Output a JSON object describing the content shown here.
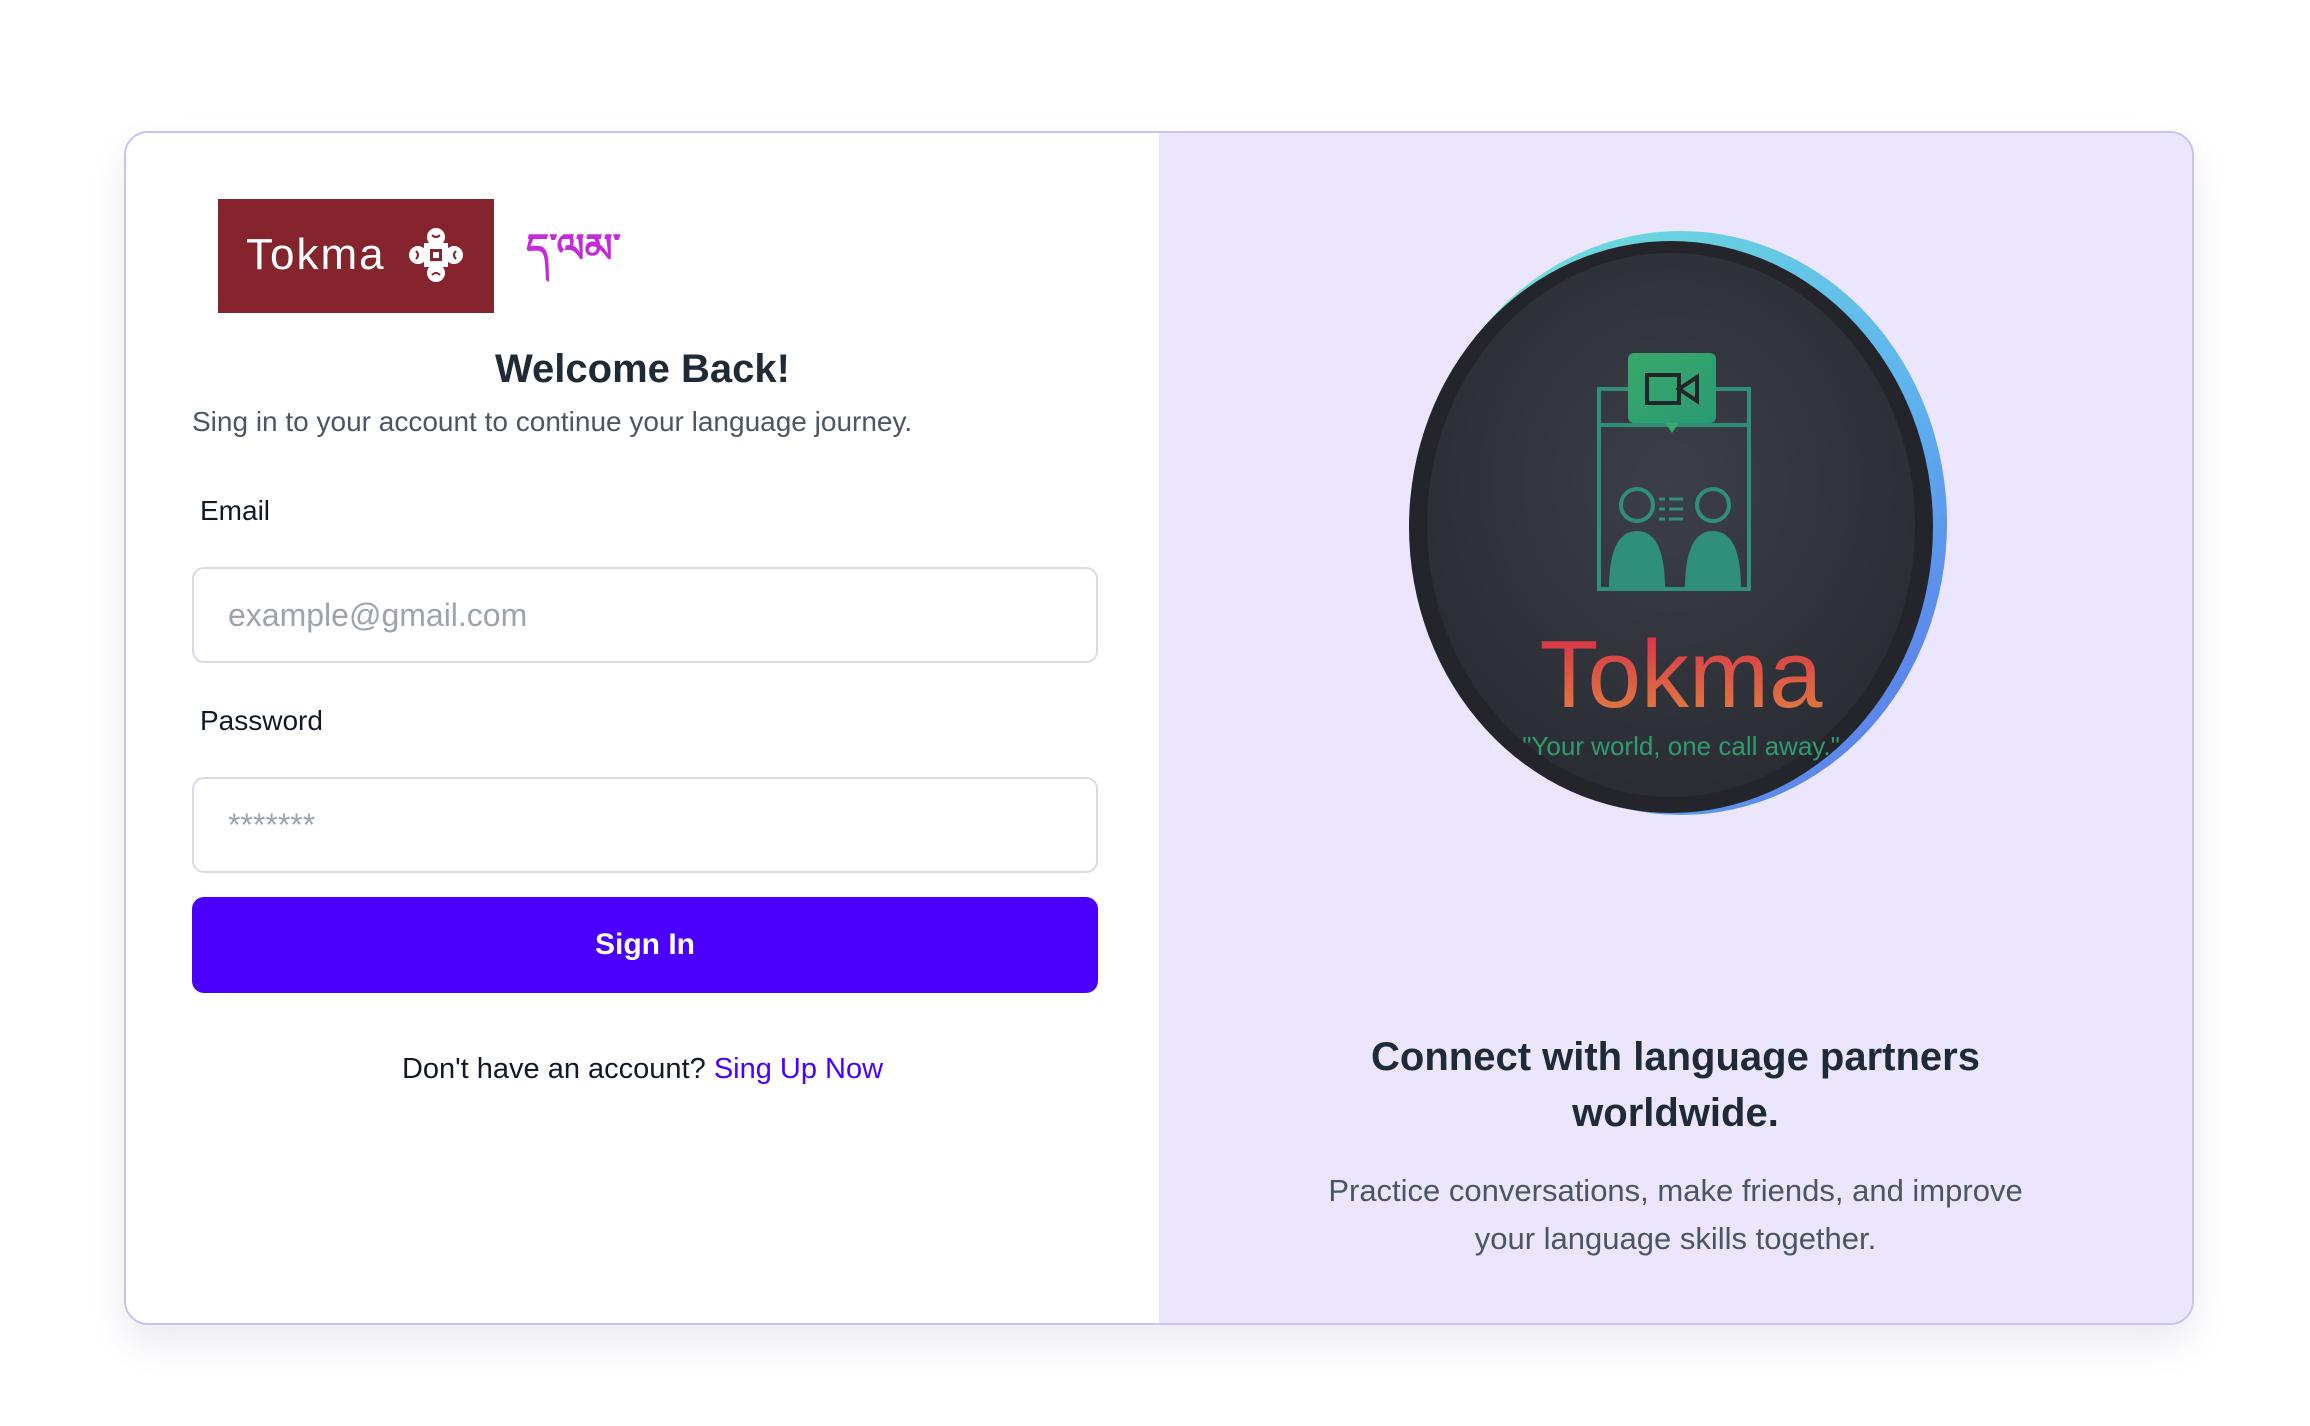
{
  "brand": {
    "name": "Tokma",
    "tibetan_name": "ད་ལམ་",
    "logo_bg": "#85242d",
    "accent": "#4b00ff",
    "panel_bg": "#ebe6fd"
  },
  "login": {
    "title": "Welcome Back!",
    "subtitle": "Sing in to your account to continue your language journey.",
    "email_label": "Email",
    "email_placeholder": "example@gmail.com",
    "password_label": "Password",
    "password_placeholder": "*******",
    "signin_label": "Sign In",
    "signup_prompt": "Don't have an account?",
    "signup_link": "Sing Up Now"
  },
  "hero": {
    "title": "Tokma",
    "slogan": "\"Your world, one call away.\"",
    "icon": "video-call-icon"
  },
  "promo": {
    "line1": "Connect with language partners",
    "line2": "worldwide.",
    "desc_line1": "Practice conversations, make friends, and improve",
    "desc_line2": "your language skills together."
  }
}
